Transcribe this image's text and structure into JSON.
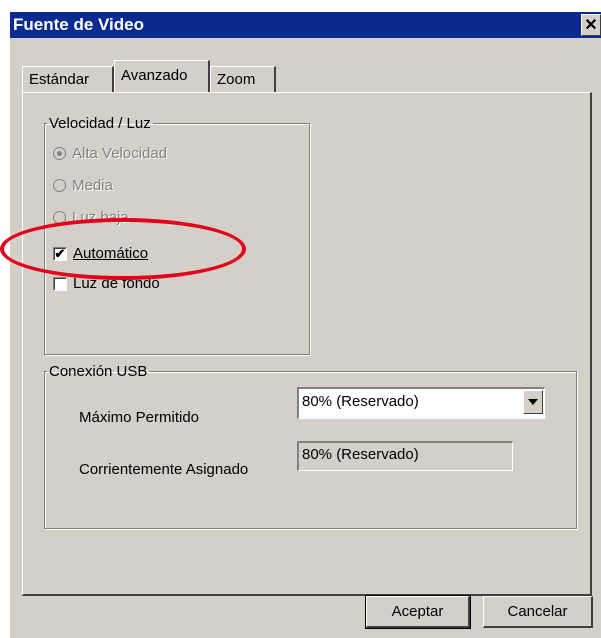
{
  "window": {
    "title": "Fuente de Video",
    "close_glyph": "✕"
  },
  "tabs": [
    {
      "label": "Estándar",
      "active": false
    },
    {
      "label": "Avanzado",
      "active": true
    },
    {
      "label": "Zoom",
      "active": false
    }
  ],
  "speed_group": {
    "legend": "Velocidad / Luz",
    "options": [
      {
        "label": "Alta Velocidad",
        "type": "radio",
        "checked": true,
        "enabled": false
      },
      {
        "label": "Media",
        "type": "radio",
        "checked": false,
        "enabled": false
      },
      {
        "label": "Luz baja",
        "type": "radio",
        "checked": false,
        "enabled": false
      },
      {
        "label": "Automático",
        "type": "checkbox",
        "checked": true,
        "enabled": true
      },
      {
        "label": "Luz de fondo",
        "type": "checkbox",
        "checked": false,
        "enabled": true
      }
    ]
  },
  "usb_group": {
    "legend": "Conexión USB",
    "max_label": "Máximo Permitido",
    "max_value": "80% (Reservado)",
    "assigned_label": "Corrientemente Asignado",
    "assigned_value": "80% (Reservado)"
  },
  "buttons": {
    "accept": "Aceptar",
    "cancel": "Cancelar"
  },
  "icons": {
    "check": "✔",
    "dropdown_arrow": "chevron-down-icon"
  },
  "colors": {
    "titlebar": "#0b2a8f",
    "annotation": "#e3001b",
    "dialog": "#d4d0c8"
  }
}
